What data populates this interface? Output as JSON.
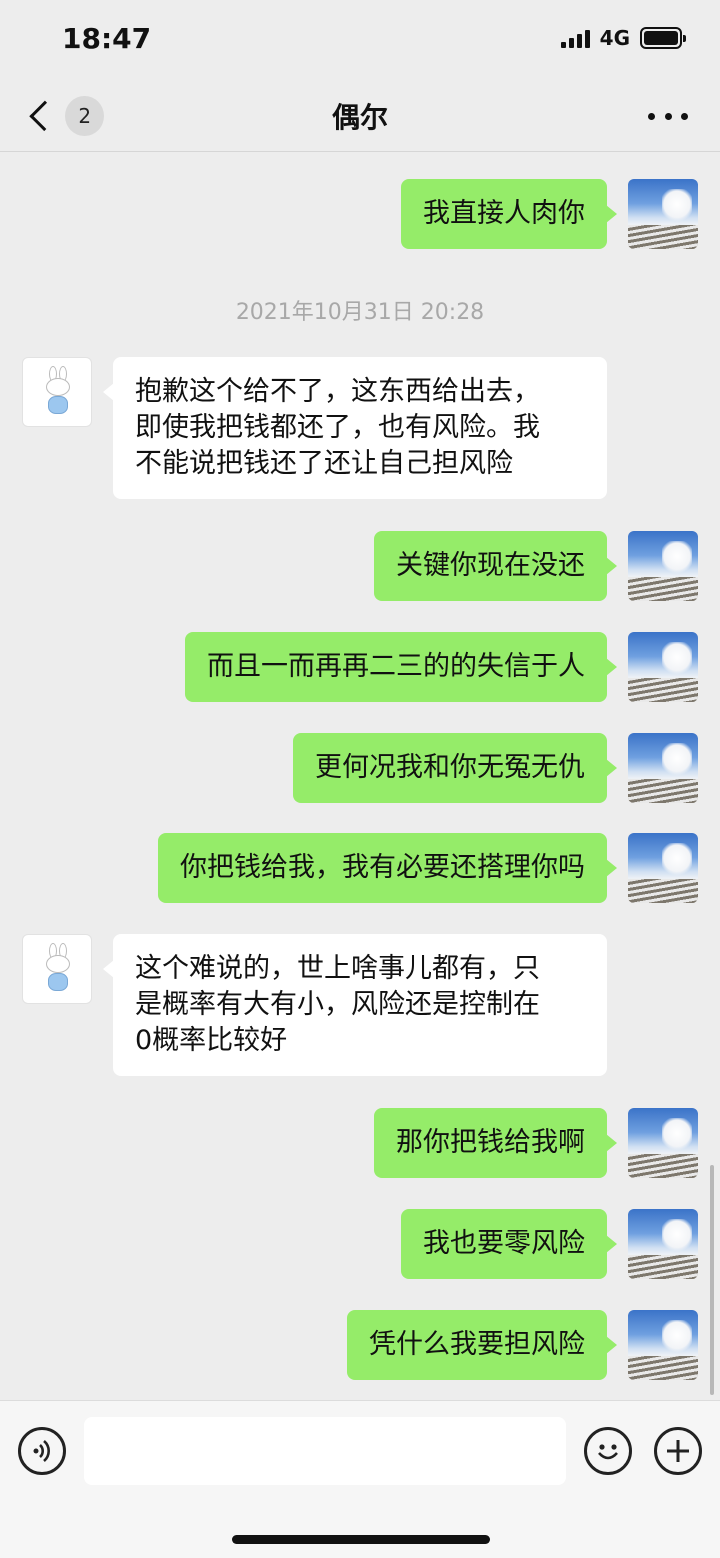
{
  "status_bar": {
    "time": "18:47",
    "network": "4G"
  },
  "nav": {
    "unread_badge": "2",
    "title": "偶尔",
    "back_icon": "chevron-left-icon",
    "more_icon": "more-dots-icon"
  },
  "timestamp": "2021年10月31日 20:28",
  "messages": [
    {
      "direction": "out",
      "text": "我直接人肉你"
    },
    {
      "direction": "in",
      "lines": [
        "抱歉这个给不了，这东西给出去，",
        "即使我把钱都还了，也有风险。我",
        "不能说把钱还了还让自己担风险"
      ]
    },
    {
      "direction": "out",
      "text": "关键你现在没还"
    },
    {
      "direction": "out",
      "text": "而且一而再再二三的的失信于人"
    },
    {
      "direction": "out",
      "text": "更何况我和你无冤无仇"
    },
    {
      "direction": "out",
      "text": "你把钱给我，我有必要还搭理你吗"
    },
    {
      "direction": "in",
      "lines": [
        "这个难说的，世上啥事儿都有，只",
        "是概率有大有小，风险还是控制在",
        "0概率比较好"
      ]
    },
    {
      "direction": "out",
      "text": "那你把钱给我啊"
    },
    {
      "direction": "out",
      "text": "我也要零风险"
    },
    {
      "direction": "out",
      "text": "凭什么我要担风险"
    }
  ],
  "input_bar": {
    "input_value": "",
    "voice_icon": "voice-icon",
    "emoji_icon": "emoji-icon",
    "plus_icon": "plus-icon"
  },
  "colors": {
    "background": "#ededed",
    "outgoing_bubble": "#95ec69",
    "incoming_bubble": "#ffffff"
  }
}
